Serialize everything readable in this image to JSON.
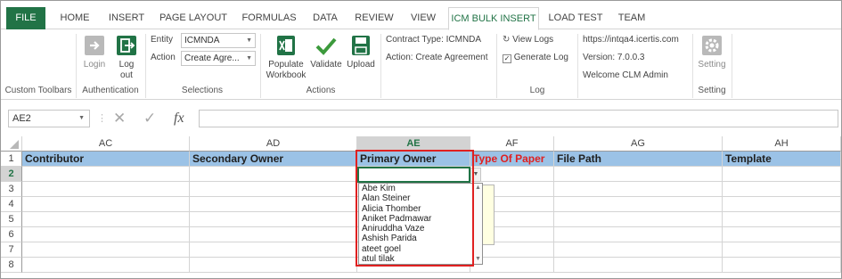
{
  "tabs": [
    "FILE",
    "HOME",
    "INSERT",
    "PAGE LAYOUT",
    "FORMULAS",
    "DATA",
    "REVIEW",
    "VIEW",
    "ICM BULK INSERT",
    "LOAD TEST",
    "TEAM"
  ],
  "active_tab": "ICM BULK INSERT",
  "ribbon": {
    "custom_toolbars_label": "Custom Toolbars",
    "authentication": {
      "label": "Authentication",
      "login": "Login",
      "logout_line1": "Log",
      "logout_line2": "out"
    },
    "selections": {
      "label": "Selections",
      "entity_label": "Entity",
      "entity_value": "ICMNDA",
      "action_label": "Action",
      "action_value": "Create Agre..."
    },
    "actions": {
      "label": "Actions",
      "populate_line1": "Populate",
      "populate_line2": "Workbook",
      "validate": "Validate",
      "upload": "Upload"
    },
    "info": {
      "contract_type": "Contract Type: ICMNDA",
      "action": "Action: Create Agreement"
    },
    "log": {
      "label": "Log",
      "view_logs": "View Logs",
      "generate_log": "Generate Log",
      "generate_log_checked": true
    },
    "server": {
      "url": "https://intqa4.icertis.com",
      "version": "Version: 7.0.0.3",
      "welcome": "Welcome CLM Admin"
    },
    "setting": {
      "label": "Setting",
      "button": "Setting"
    }
  },
  "formula_bar": {
    "name_box": "AE2",
    "cancel_symbol": "✕",
    "enter_symbol": "✓",
    "fx_symbol": "fx",
    "value": ""
  },
  "sheet": {
    "columns": [
      "AC",
      "AD",
      "AE",
      "AF",
      "AG",
      "AH"
    ],
    "selected_column": "AE",
    "rows": [
      "1",
      "2",
      "3",
      "4",
      "5",
      "6",
      "7",
      "8"
    ],
    "selected_row": "2",
    "header_row": [
      "Contributor",
      "Secondary Owner",
      "Primary Owner",
      "Type Of Paper",
      "File Path",
      "Template"
    ],
    "active_cell": "AE2"
  },
  "dropdown": {
    "items": [
      "Abe Kim",
      "Alan Steiner",
      "Alicia Thomber",
      "Aniket Padmawar",
      "Aniruddha Vaze",
      "Ashish Parida",
      "ateet goel",
      "atul tilak"
    ]
  },
  "colors": {
    "excel_green": "#217346",
    "header_fill": "#9bc2e6",
    "highlight_red": "#e02020"
  }
}
